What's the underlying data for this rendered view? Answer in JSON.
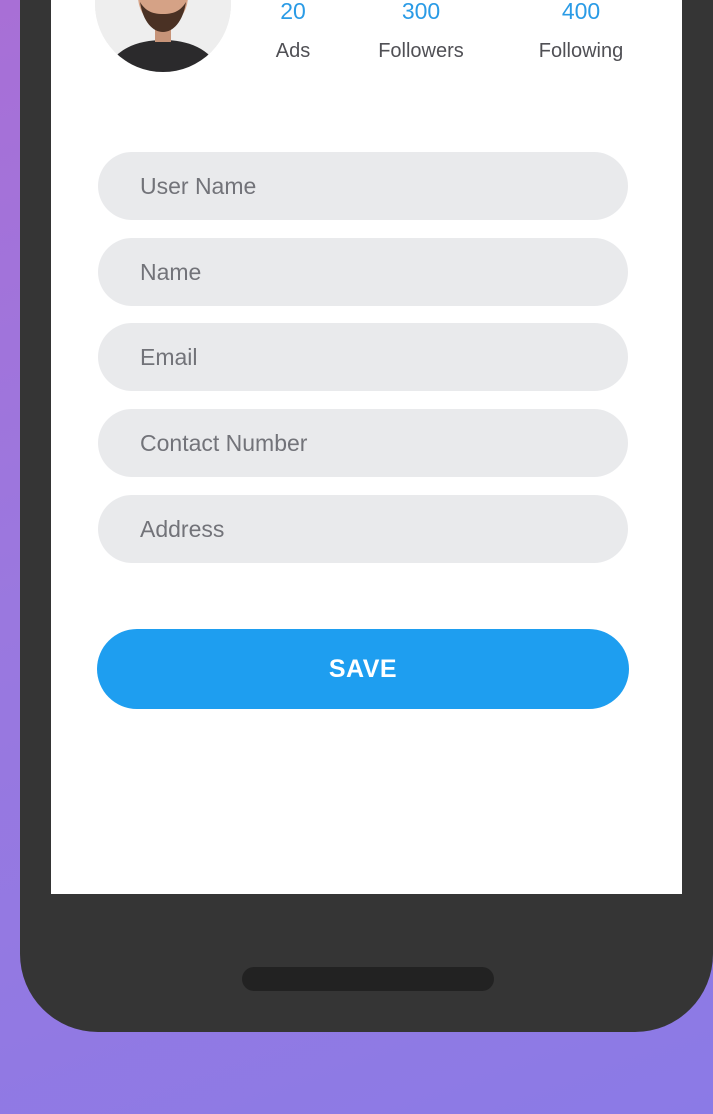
{
  "profile": {
    "avatar_alt": "Profile photo",
    "stats": [
      {
        "value": "20",
        "label": "Ads"
      },
      {
        "value": "300",
        "label": "Followers"
      },
      {
        "value": "400",
        "label": "Following"
      }
    ]
  },
  "form": {
    "fields": [
      {
        "placeholder": "User Name"
      },
      {
        "placeholder": "Name"
      },
      {
        "placeholder": "Email"
      },
      {
        "placeholder": "Contact Number"
      },
      {
        "placeholder": "Address"
      }
    ],
    "save_label": "SAVE"
  },
  "colors": {
    "accent": "#1e9ef0",
    "stat_value": "#2a9be6",
    "phone_frame": "#353535",
    "background_gradient": [
      "#a86fd6",
      "#8b7ae6"
    ]
  }
}
